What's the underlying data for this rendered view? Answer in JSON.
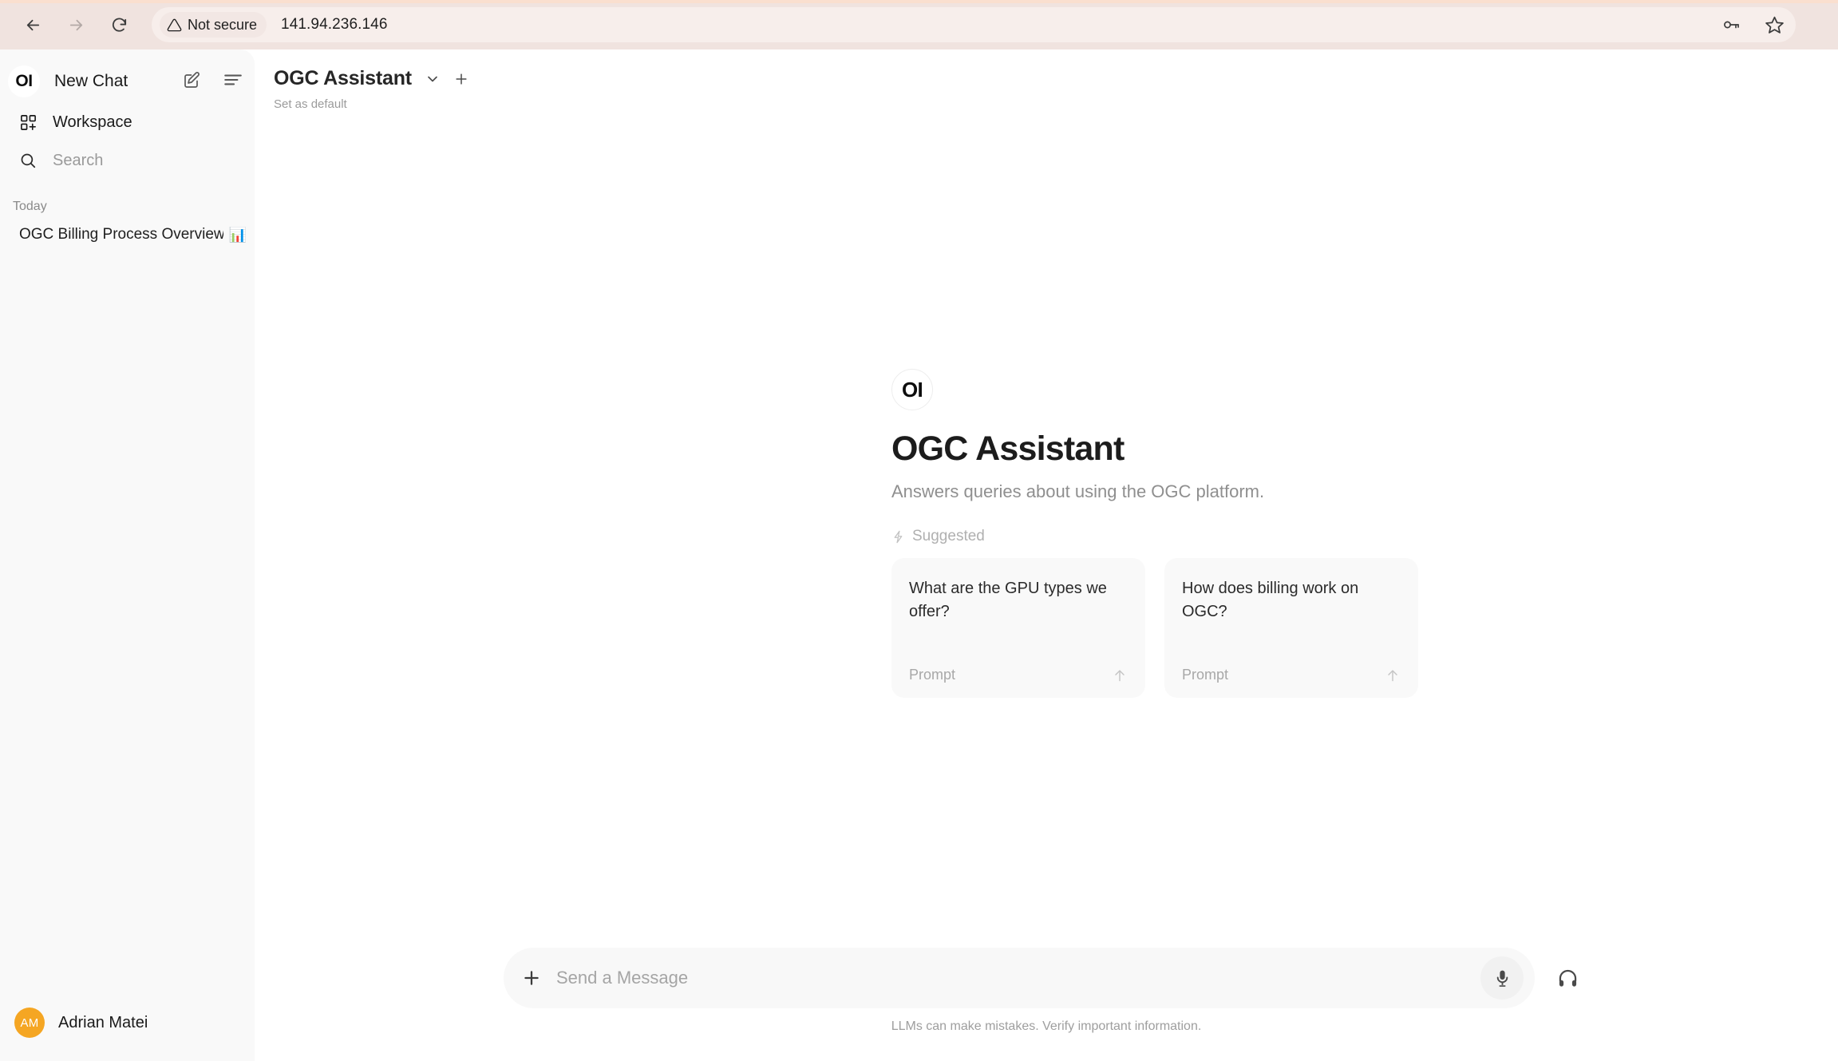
{
  "browser": {
    "back_icon": "arrow-left-icon",
    "forward_icon": "arrow-right-icon",
    "reload_icon": "reload-icon",
    "security_label": "Not secure",
    "security_icon": "warning-triangle-icon",
    "url": "141.94.236.146",
    "password_key_icon": "key-icon",
    "bookmark_icon": "star-icon",
    "chrome_color": "#f0e3df"
  },
  "sidebar": {
    "brand_mark": "OI",
    "new_chat_label": "New Chat",
    "compose_icon": "compose-pencil-icon",
    "panel_toggle_icon": "sidebar-toggle-icon",
    "items": [
      {
        "label": "Workspace",
        "icon": "workspace-grid-plus-icon"
      },
      {
        "label": "Search",
        "icon": "search-icon"
      }
    ],
    "section_label": "Today",
    "chats": [
      {
        "title": "OGC Billing Process Overview",
        "emoji": "📊"
      }
    ],
    "user": {
      "initials": "AM",
      "name": "Adrian Matei",
      "avatar_color": "#f5a623"
    },
    "background": "#f9f9f9"
  },
  "header": {
    "model_name": "OGC Assistant",
    "chevron_icon": "chevron-down-icon",
    "new_icon": "plus-icon",
    "set_default_label": "Set as default"
  },
  "welcome": {
    "logo_mark": "OI",
    "title": "OGC Assistant",
    "subtitle": "Answers queries about using the OGC platform.",
    "suggested_label": "Suggested",
    "suggested_icon": "lightning-bolt-icon",
    "cards": [
      {
        "question": "What are the GPU types we offer?",
        "type_label": "Prompt",
        "action_icon": "arrow-up-icon"
      },
      {
        "question": "How does billing work on OGC?",
        "type_label": "Prompt",
        "action_icon": "arrow-up-icon"
      }
    ]
  },
  "composer": {
    "attach_icon": "plus-icon",
    "placeholder": "Send a Message",
    "value": "",
    "mic_icon": "microphone-icon",
    "voice_call_icon": "headphones-icon",
    "disclaimer": "LLMs can make mistakes. Verify important information."
  }
}
